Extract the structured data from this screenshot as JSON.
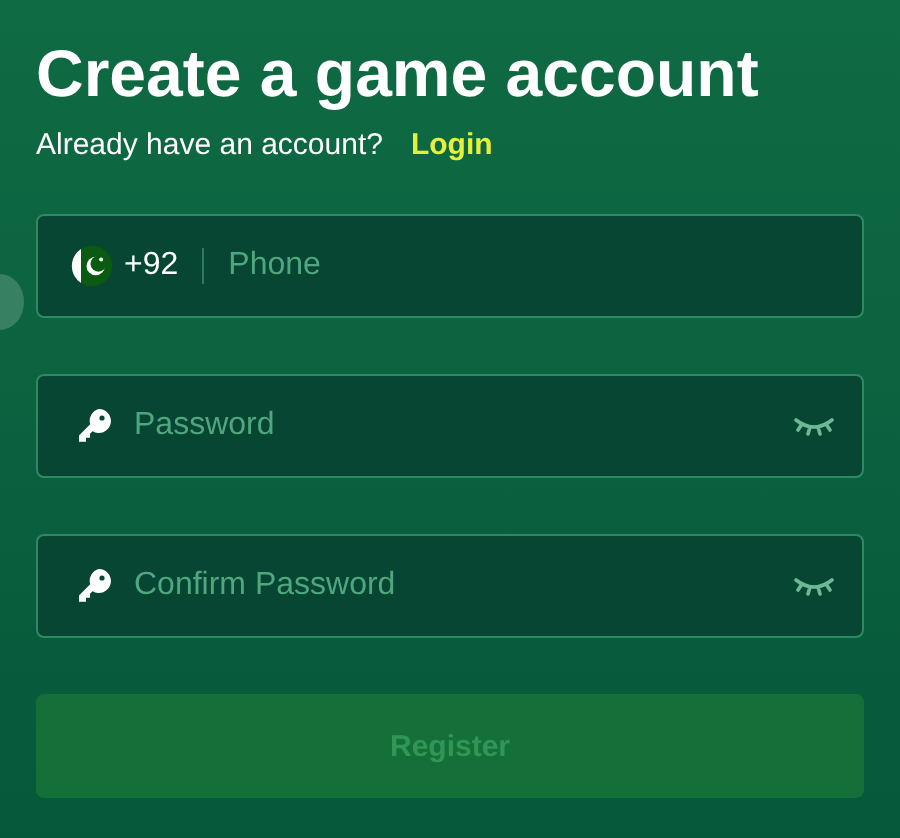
{
  "title": "Create a game account",
  "login_prompt": {
    "text": "Already have an account?",
    "link": "Login"
  },
  "fields": [
    {
      "kind": "phone",
      "country_code": "+92",
      "placeholder": "Phone"
    },
    {
      "kind": "password",
      "placeholder": "Password",
      "visible": false
    },
    {
      "kind": "password",
      "placeholder": "Confirm Password",
      "visible": false
    }
  ],
  "register_button": {
    "label": "Register",
    "disabled": true
  }
}
